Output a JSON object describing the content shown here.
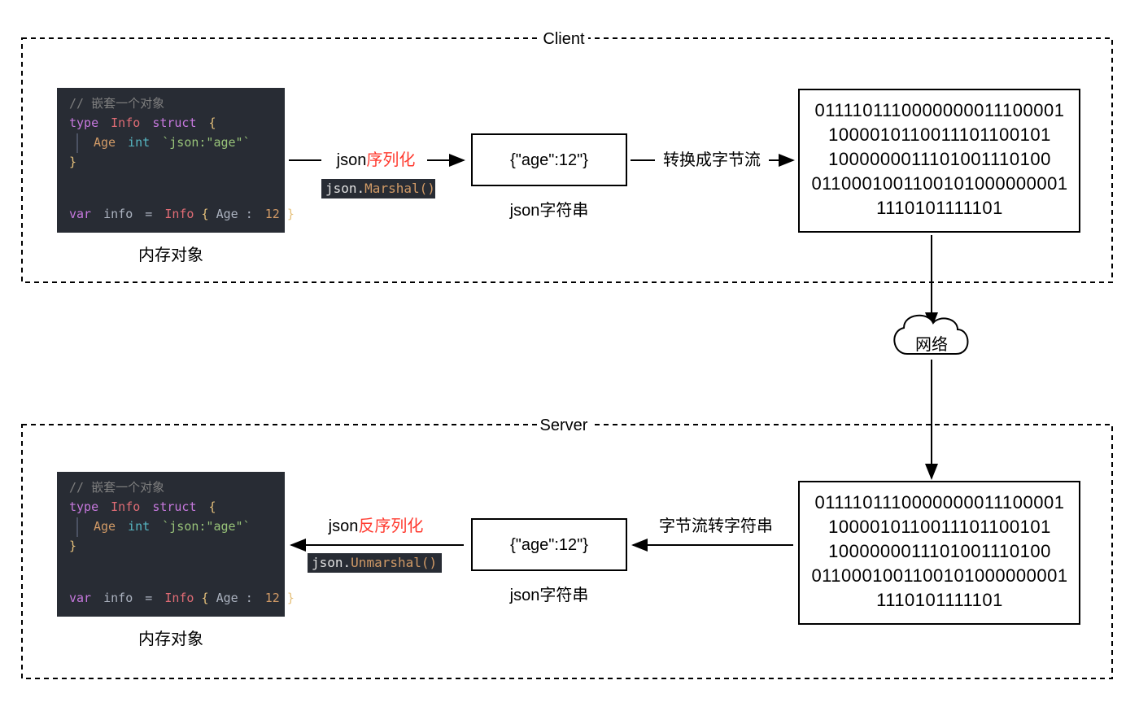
{
  "client": {
    "title": "Client",
    "code": {
      "comment": "// 嵌套一个对象",
      "line2_type": "type",
      "line2_name": "Info",
      "line2_struct": "struct",
      "line2_brace": "{",
      "line3_field": "Age",
      "line3_type": "int",
      "line3_tag": "`json:\"age\"`",
      "line4_brace": "}",
      "line5_var": "var",
      "line5_name": "info",
      "line5_eq": "=",
      "line5_type": "Info",
      "line5_openb": "{",
      "line5_field": "Age",
      "line5_colon": ":",
      "line5_num": "12",
      "line5_closeb": "}"
    },
    "code_label": "内存对象",
    "arrow1_prefix": "json",
    "arrow1_red": "序列化",
    "snippet_prefix": "json.",
    "snippet_fn": "Marshal()",
    "json_box": "{\"age\":12\"}",
    "json_label": "json字符串",
    "arrow2_label": "转换成字节流",
    "binary_lines": [
      "0111101110000000011100001",
      "1000010110011101100101",
      "1000000011101001110100",
      "0110001001100101000000001",
      "1110101111101"
    ]
  },
  "network_label": "网络",
  "server": {
    "title": "Server",
    "code_label": "内存对象",
    "arrow1_prefix": "json",
    "arrow1_red": "反序列化",
    "snippet_prefix": "json.",
    "snippet_fn": "Unmarshal()",
    "json_box": "{\"age\":12\"}",
    "json_label": "json字符串",
    "arrow2_label": "字节流转字符串",
    "binary_lines": [
      "0111101110000000011100001",
      "1000010110011101100101",
      "1000000011101001110100",
      "0110001001100101000000001",
      "1110101111101"
    ]
  }
}
